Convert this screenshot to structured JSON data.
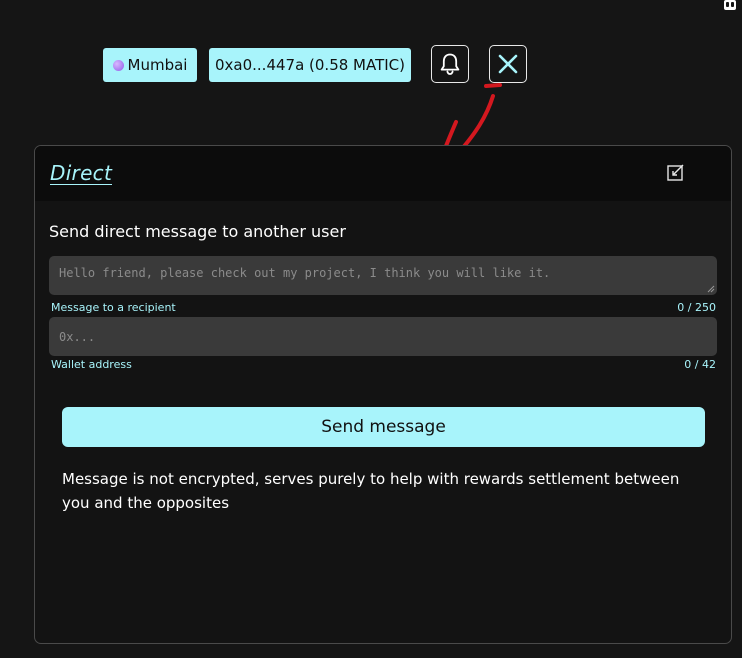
{
  "header": {
    "network_label": "Mumbai",
    "wallet_label": "0xa0...447a (0.58 MATIC)"
  },
  "panel": {
    "title": "Direct",
    "heading": "Send direct message to another user",
    "message_field": {
      "placeholder": "Hello friend, please check out my project, I think you will like it.",
      "value": "",
      "helper": "Message to a recipient",
      "counter": "0 / 250"
    },
    "wallet_field": {
      "placeholder": "0x...",
      "value": "",
      "helper": "Wallet address",
      "counter": "0 / 42"
    },
    "send_label": "Send message",
    "notice": "Message is not encrypted, serves purely to help with rewards settlement between you and the opposites"
  },
  "colors": {
    "accent": "#a8f4fb",
    "background": "#151515",
    "panel_header": "#0c0c0c",
    "field_background": "#3a3a3a",
    "annotation_arrow": "#d4181f"
  },
  "icons": {
    "network": "polygon-network-icon",
    "bell": "bell-icon",
    "close": "close-icon",
    "compose": "compose-icon"
  }
}
